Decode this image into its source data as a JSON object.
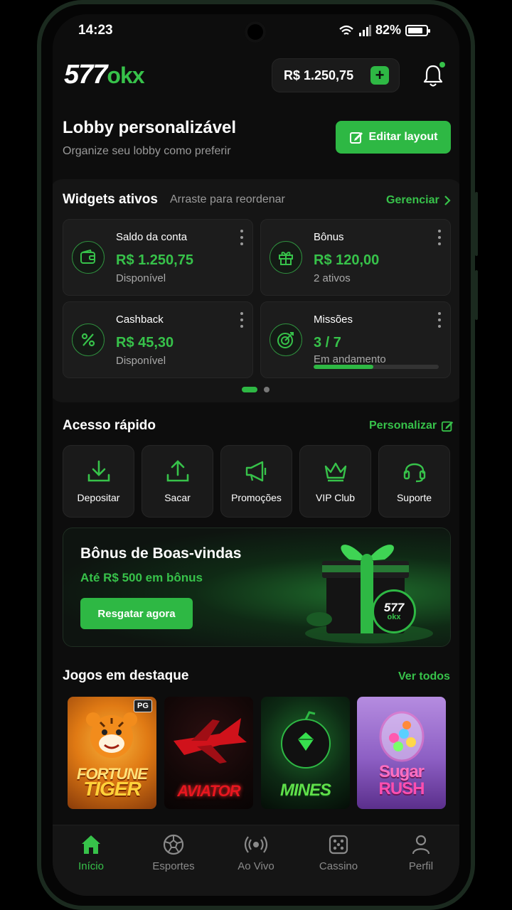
{
  "status_bar": {
    "time": "14:23",
    "battery": "82%",
    "battery_level": 0.82
  },
  "header": {
    "logo_number": "577",
    "logo_suffix": "okx",
    "balance": "R$ 1.250,75",
    "add_label": "+"
  },
  "lobby": {
    "title": "Lobby personalizável",
    "subtitle": "Organize seu lobby como preferir",
    "edit_button": "Editar layout"
  },
  "widgets": {
    "title": "Widgets ativos",
    "hint": "Arraste para reordenar",
    "manage_label": "Gerenciar",
    "items": [
      {
        "label": "Saldo da conta",
        "value": "R$ 1.250,75",
        "note": "Disponível",
        "icon": "wallet-icon"
      },
      {
        "label": "Bônus",
        "value": "R$ 120,00",
        "note": "2 ativos",
        "icon": "gift-icon"
      },
      {
        "label": "Cashback",
        "value": "R$ 45,30",
        "note": "Disponível",
        "icon": "percent-icon"
      },
      {
        "label": "Missões",
        "value": "3 / 7",
        "note": "Em andamento",
        "icon": "target-icon",
        "progress": 0.48
      }
    ]
  },
  "quick_access": {
    "title": "Acesso rápido",
    "customize_label": "Personalizar",
    "items": [
      {
        "label": "Depositar",
        "icon": "download-icon"
      },
      {
        "label": "Sacar",
        "icon": "upload-icon"
      },
      {
        "label": "Promoções",
        "icon": "megaphone-icon"
      },
      {
        "label": "VIP Club",
        "icon": "crown-icon"
      },
      {
        "label": "Suporte",
        "icon": "headset-icon"
      }
    ]
  },
  "bonus_banner": {
    "title": "Bônus de Boas-vindas",
    "subtitle": "Até R$ 500 em bônus",
    "button": "Resgatar agora",
    "coin_text": "577",
    "coin_subtext": "okx"
  },
  "featured_games": {
    "title": "Jogos em destaque",
    "see_all": "Ver todos",
    "items": [
      {
        "name_line1": "FORTUNE",
        "name_line2": "TIGER",
        "badge": "PG"
      },
      {
        "name_line1": "AVIATOR",
        "name_line2": ""
      },
      {
        "name_line1": "MINES",
        "name_line2": ""
      },
      {
        "name_line1": "Sugar",
        "name_line2": "RUSH"
      }
    ]
  },
  "bottom_nav": {
    "items": [
      {
        "label": "Início",
        "icon": "home-icon",
        "active": true
      },
      {
        "label": "Esportes",
        "icon": "soccer-ball-icon"
      },
      {
        "label": "Ao Vivo",
        "icon": "live-broadcast-icon"
      },
      {
        "label": "Cassino",
        "icon": "dice-icon"
      },
      {
        "label": "Perfil",
        "icon": "user-icon"
      }
    ]
  },
  "colors": {
    "accent": "#2eb844",
    "accent_text": "#37c24a",
    "background": "#0d0d0d",
    "card": "#1c1c1c"
  }
}
